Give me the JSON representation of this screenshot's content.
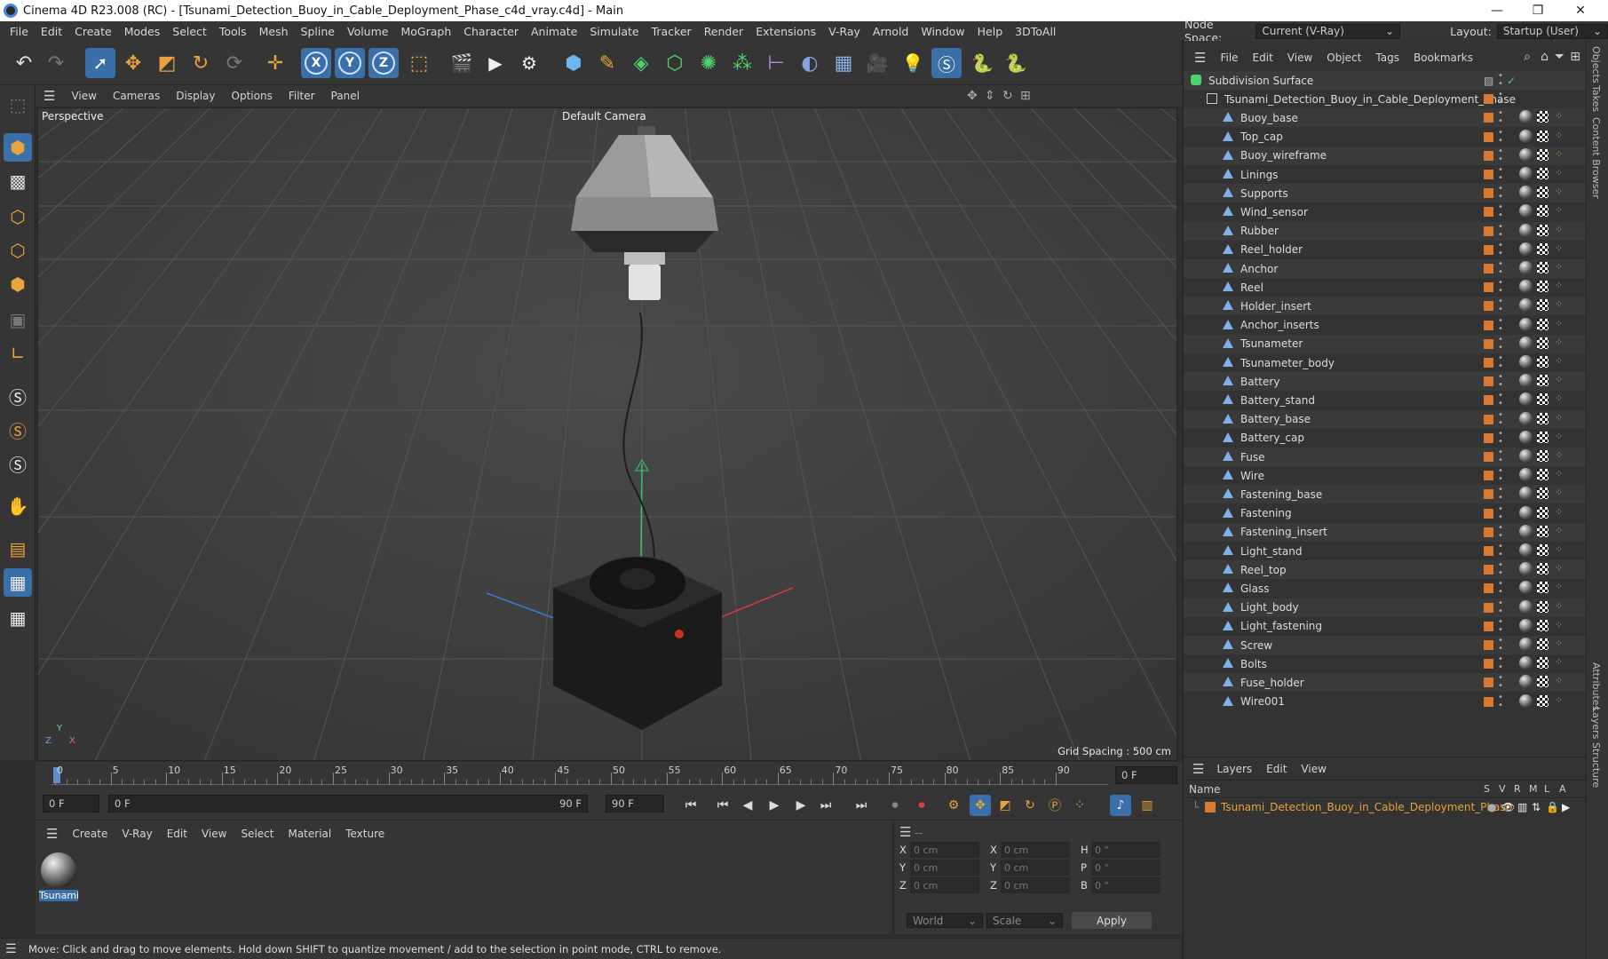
{
  "window": {
    "title": "Cinema 4D R23.008 (RC) - [Tsunami_Detection_Buoy_in_Cable_Deployment_Phase_c4d_vray.c4d] - Main"
  },
  "menu": [
    "File",
    "Edit",
    "Create",
    "Modes",
    "Select",
    "Tools",
    "Mesh",
    "Spline",
    "Volume",
    "MoGraph",
    "Character",
    "Animate",
    "Simulate",
    "Tracker",
    "Render",
    "Extensions",
    "V-Ray",
    "Arnold",
    "Window",
    "Help",
    "3DToAll"
  ],
  "nodespace": {
    "label": "Node Space:",
    "value": "Current (V-Ray)",
    "layout_label": "Layout:",
    "layout_value": "Startup (User)"
  },
  "viewport": {
    "menu": [
      "View",
      "Cameras",
      "Display",
      "Options",
      "Filter",
      "Panel"
    ],
    "name": "Perspective",
    "camera": "Default Camera",
    "grid_spacing": "Grid Spacing : 500 cm"
  },
  "timeline": {
    "ticks": [
      "0",
      "5",
      "10",
      "15",
      "20",
      "25",
      "30",
      "35",
      "40",
      "45",
      "50",
      "55",
      "60",
      "65",
      "70",
      "75",
      "80",
      "85",
      "90"
    ],
    "current_frame": "0 F"
  },
  "playback": {
    "start": "0 F",
    "range_start": "0 F",
    "range_end": "90 F",
    "end": "90 F"
  },
  "materials": {
    "menu": [
      "Create",
      "V-Ray",
      "Edit",
      "View",
      "Select",
      "Material",
      "Texture"
    ],
    "items": [
      {
        "name": "Tsunami"
      }
    ]
  },
  "coords": {
    "header": "--",
    "rows": [
      {
        "a": "X",
        "av": "0 cm",
        "b": "X",
        "bv": "0 cm",
        "c": "H",
        "cv": "0 °"
      },
      {
        "a": "Y",
        "av": "0 cm",
        "b": "Y",
        "bv": "0 cm",
        "c": "P",
        "cv": "0 °"
      },
      {
        "a": "Z",
        "av": "0 cm",
        "b": "Z",
        "bv": "0 cm",
        "c": "B",
        "cv": "0 °"
      }
    ],
    "space": "World",
    "mode": "Scale",
    "apply": "Apply"
  },
  "status": "Move: Click and drag to move elements. Hold down SHIFT to quantize movement / add to the selection in point mode, CTRL to remove.",
  "objects": {
    "menu": [
      "File",
      "Edit",
      "View",
      "Object",
      "Tags",
      "Bookmarks"
    ],
    "root": "Subdivision Surface",
    "group": "Tsunami_Detection_Buoy_in_Cable_Deployment_Phase",
    "items": [
      "Buoy_base",
      "Top_cap",
      "Buoy_wireframe",
      "Linings",
      "Supports",
      "Wind_sensor",
      "Rubber",
      "Reel_holder",
      "Anchor",
      "Reel",
      "Holder_insert",
      "Anchor_inserts",
      "Tsunameter",
      "Tsunameter_body",
      "Battery",
      "Battery_stand",
      "Battery_base",
      "Battery_cap",
      "Fuse",
      "Wire",
      "Fastening_base",
      "Fastening",
      "Fastening_insert",
      "Light_stand",
      "Reel_top",
      "Glass",
      "Light_body",
      "Light_fastening",
      "Screw",
      "Bolts",
      "Fuse_holder",
      "Wire001"
    ]
  },
  "layers": {
    "menu": [
      "Layers",
      "Edit",
      "View"
    ],
    "col_name": "Name",
    "cols": [
      "S",
      "V",
      "R",
      "M",
      "L",
      "A"
    ],
    "items": [
      "Tsunami_Detection_Buoy_in_Cable_Deployment_Phase"
    ]
  },
  "sidetabs": [
    "Objects",
    "Takes",
    "Content Browser",
    "Attributes",
    "Layers",
    "Structure"
  ],
  "colors": {
    "accent": "#3a6fa8",
    "orange": "#e8a33b",
    "layer_orange": "#d9782f",
    "axis_x": "#d33b3b",
    "axis_y": "#3bc46a",
    "axis_z": "#3b78d3"
  }
}
